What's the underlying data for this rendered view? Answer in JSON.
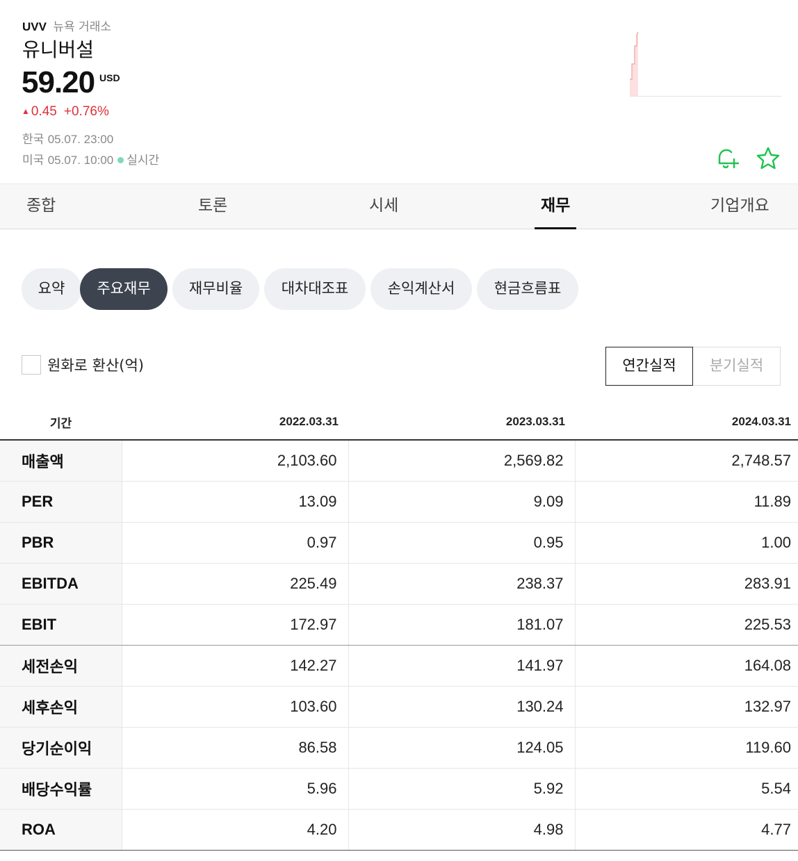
{
  "stock": {
    "ticker": "UVV",
    "exchange": "뉴욕 거래소",
    "name": "유니버설",
    "price": "59.20",
    "currency": "USD",
    "change": "0.45",
    "change_pct": "+0.76%",
    "time_kr_label": "한국",
    "time_kr": "05.07. 23:00",
    "time_us_label": "미국",
    "time_us": "05.07. 10:00",
    "realtime_label": "실시간"
  },
  "icons": {
    "alert": "bell-plus-icon",
    "favorite": "star-icon",
    "up": "triangle-up-icon"
  },
  "colors": {
    "up": "#e0303a",
    "accent": "#1ec34f",
    "active_pill": "#3d4450"
  },
  "tabs": [
    {
      "label": "종합"
    },
    {
      "label": "토론"
    },
    {
      "label": "시세"
    },
    {
      "label": "재무",
      "active": true
    },
    {
      "label": "기업개요"
    }
  ],
  "subtabs": [
    {
      "label": "요약"
    },
    {
      "label": "주요재무",
      "active": true
    },
    {
      "label": "재무비율"
    },
    {
      "label": "대차대조표"
    },
    {
      "label": "손익계산서"
    },
    {
      "label": "현금흐름표"
    }
  ],
  "convert_label": "원화로 환산(억)",
  "period_toggle": {
    "annual": "연간실적",
    "quarterly": "분기실적",
    "selected": "annual"
  },
  "table": {
    "period_header": "기간",
    "columns": [
      "2022.03.31",
      "2023.03.31",
      "2024.03.31"
    ],
    "rows": [
      {
        "label": "매출액",
        "values": [
          "2,103.60",
          "2,569.82",
          "2,748.57"
        ]
      },
      {
        "label": "PER",
        "values": [
          "13.09",
          "9.09",
          "11.89"
        ]
      },
      {
        "label": "PBR",
        "values": [
          "0.97",
          "0.95",
          "1.00"
        ]
      },
      {
        "label": "EBITDA",
        "values": [
          "225.49",
          "238.37",
          "283.91"
        ]
      },
      {
        "label": "EBIT",
        "values": [
          "172.97",
          "181.07",
          "225.53"
        ]
      },
      {
        "label": "세전손익",
        "values": [
          "142.27",
          "141.97",
          "164.08"
        ]
      },
      {
        "label": "세후손익",
        "values": [
          "103.60",
          "130.24",
          "132.97"
        ]
      },
      {
        "label": "당기순이익",
        "values": [
          "86.58",
          "124.05",
          "119.60"
        ]
      },
      {
        "label": "배당수익률",
        "values": [
          "5.96",
          "5.92",
          "5.54"
        ]
      },
      {
        "label": "ROA",
        "values": [
          "4.20",
          "4.98",
          "4.77"
        ]
      }
    ]
  }
}
